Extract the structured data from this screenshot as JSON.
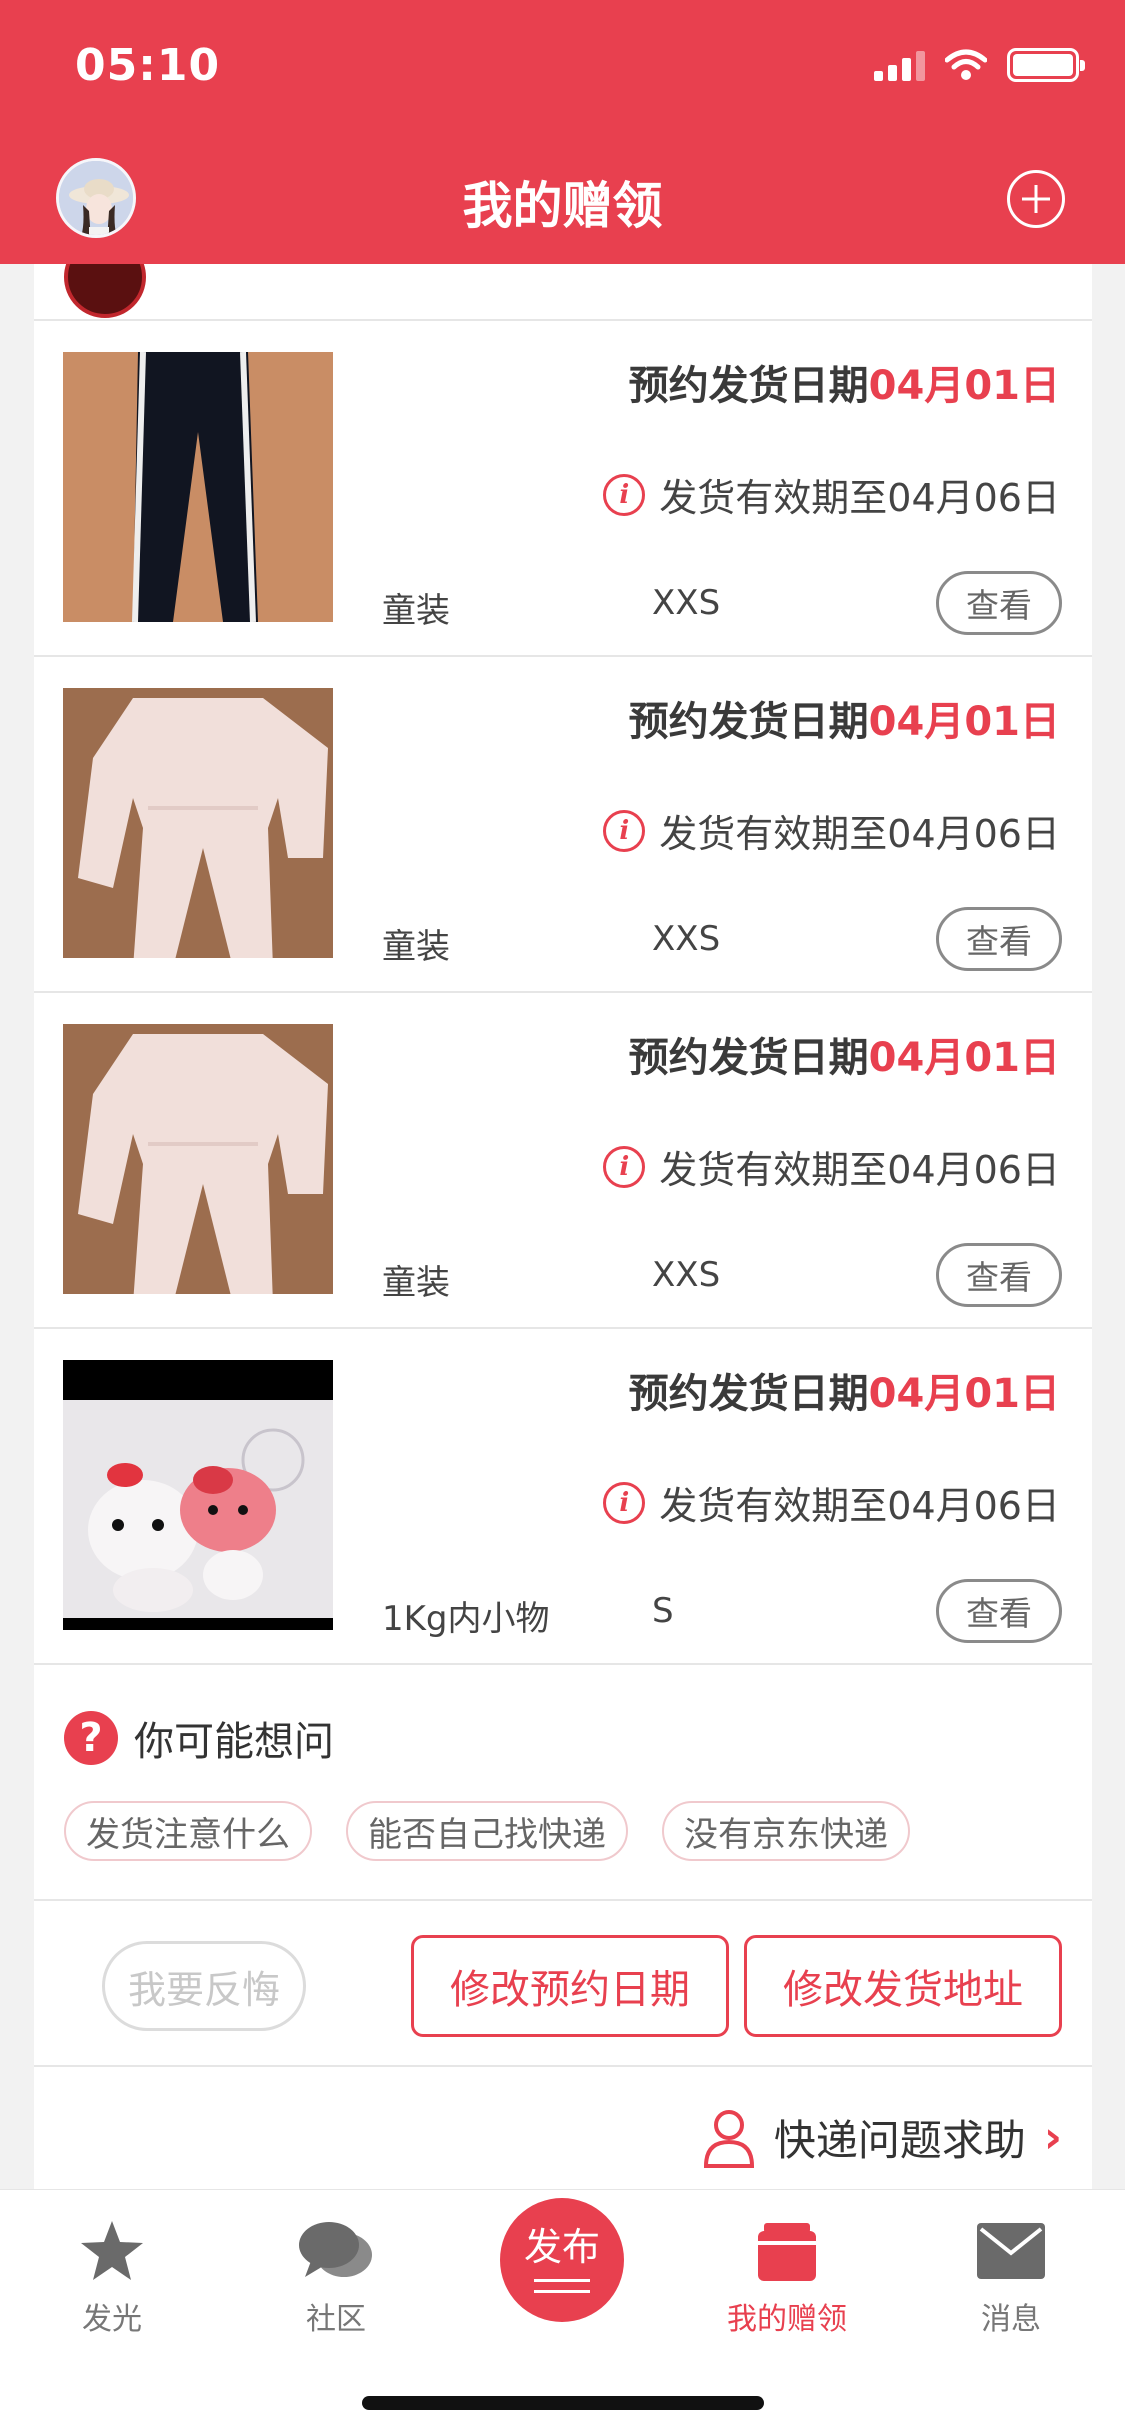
{
  "status_bar": {
    "time": "05:10"
  },
  "header": {
    "title": "我的赠领"
  },
  "items": [
    {
      "date_label": "预约发货日期",
      "date_value": "04月01日",
      "validity": "发货有效期至04月06日",
      "category": "童装",
      "size": "XXS",
      "view_label": "查看",
      "thumb": "black-pants"
    },
    {
      "date_label": "预约发货日期",
      "date_value": "04月01日",
      "validity": "发货有效期至04月06日",
      "category": "童装",
      "size": "XXS",
      "view_label": "查看",
      "thumb": "pink-pajamas"
    },
    {
      "date_label": "预约发货日期",
      "date_value": "04月01日",
      "validity": "发货有效期至04月06日",
      "category": "童装",
      "size": "XXS",
      "view_label": "查看",
      "thumb": "pink-pajamas"
    },
    {
      "date_label": "预约发货日期",
      "date_value": "04月01日",
      "validity": "发货有效期至04月06日",
      "category": "1Kg内小物",
      "size": "S",
      "view_label": "查看",
      "thumb": "plush-toys"
    }
  ],
  "faq": {
    "title": "你可能想问",
    "chips": [
      "发货注意什么",
      "能否自己找快递",
      "没有京东快递"
    ]
  },
  "actions": {
    "regret": "我要反悔",
    "change_date": "修改预约日期",
    "change_address": "修改发货地址"
  },
  "help": {
    "label": "快递问题求助"
  },
  "tabbar": {
    "tabs": [
      {
        "label": "发光",
        "icon": "star-icon"
      },
      {
        "label": "社区",
        "icon": "chat-bubbles-icon"
      },
      {
        "label": "发布",
        "icon": "publish-icon"
      },
      {
        "label": "我的赠领",
        "icon": "gift-box-icon",
        "active": true
      },
      {
        "label": "消息",
        "icon": "envelope-icon"
      }
    ]
  },
  "colors": {
    "accent": "#e8404f",
    "background": "#f2f2f2"
  }
}
